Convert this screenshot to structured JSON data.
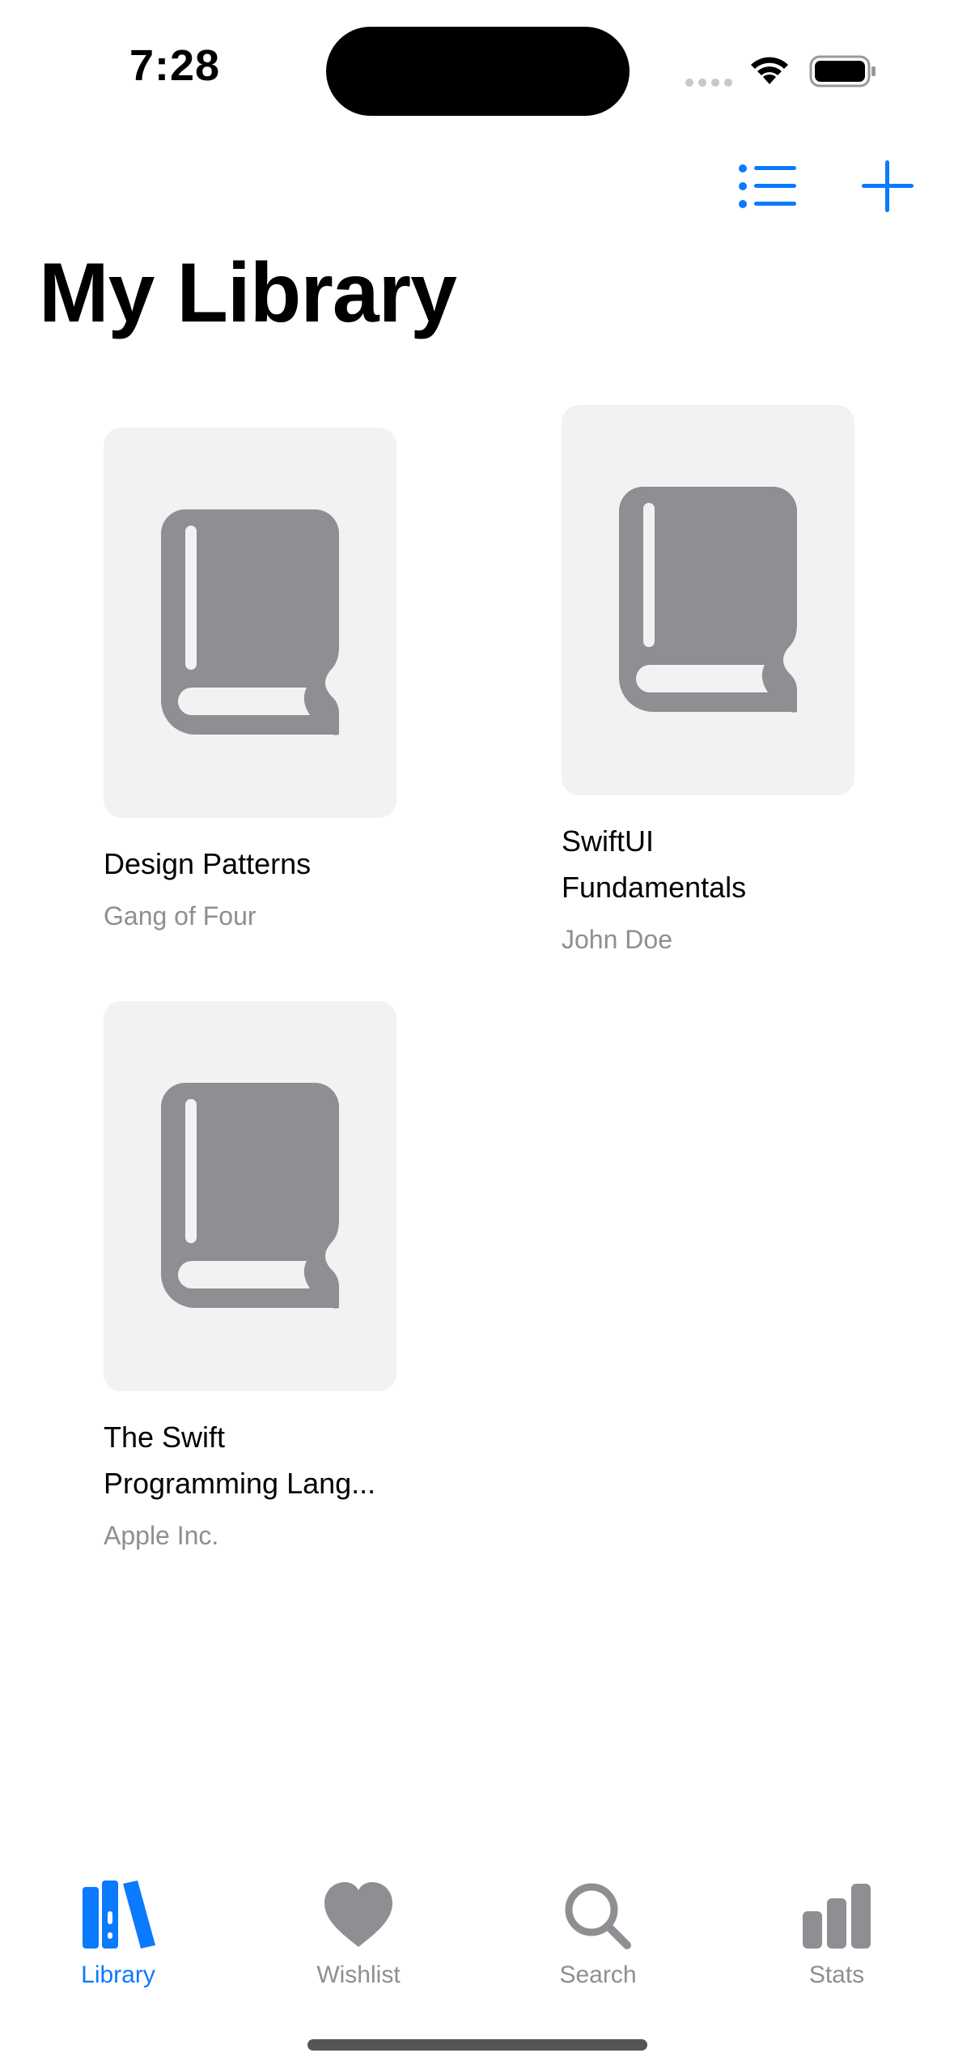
{
  "status_bar": {
    "time": "7:28"
  },
  "toolbar": {
    "list_icon": "list-bullet-icon",
    "add_icon": "plus-icon",
    "accent_color": "#0a7aff"
  },
  "page": {
    "title": "My Library"
  },
  "books": [
    {
      "title": "Design Patterns",
      "author": "Gang of Four",
      "cover_icon": "book-icon"
    },
    {
      "title": "SwiftUI\nFundamentals",
      "author": "John Doe",
      "cover_icon": "book-icon"
    },
    {
      "title": "The Swift\nProgramming Lang...",
      "author": "Apple Inc.",
      "cover_icon": "book-icon"
    }
  ],
  "tab_bar": {
    "items": [
      {
        "label": "Library",
        "icon": "books-icon",
        "active": true
      },
      {
        "label": "Wishlist",
        "icon": "heart-icon",
        "active": false
      },
      {
        "label": "Search",
        "icon": "magnifying-glass-icon",
        "active": false
      },
      {
        "label": "Stats",
        "icon": "bar-chart-icon",
        "active": false
      }
    ],
    "active_color": "#0a7aff",
    "inactive_color": "#8e8e93"
  }
}
